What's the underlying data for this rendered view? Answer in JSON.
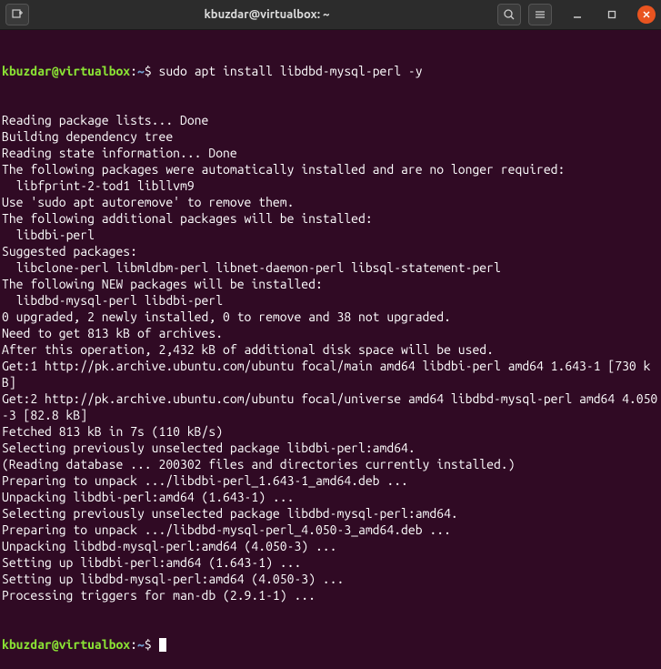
{
  "titlebar": {
    "title": "kbuzdar@virtualbox: ~"
  },
  "prompt": {
    "user": "kbuzdar@virtualbox",
    "path": "~",
    "symbol": "$"
  },
  "command": "sudo apt install libdbd-mysql-perl -y",
  "output_lines": [
    "Reading package lists... Done",
    "Building dependency tree",
    "Reading state information... Done",
    "The following packages were automatically installed and are no longer required:",
    "  libfprint-2-tod1 libllvm9",
    "Use 'sudo apt autoremove' to remove them.",
    "The following additional packages will be installed:",
    "  libdbi-perl",
    "Suggested packages:",
    "  libclone-perl libmldbm-perl libnet-daemon-perl libsql-statement-perl",
    "The following NEW packages will be installed:",
    "  libdbd-mysql-perl libdbi-perl",
    "0 upgraded, 2 newly installed, 0 to remove and 38 not upgraded.",
    "Need to get 813 kB of archives.",
    "After this operation, 2,432 kB of additional disk space will be used.",
    "Get:1 http://pk.archive.ubuntu.com/ubuntu focal/main amd64 libdbi-perl amd64 1.643-1 [730 kB]",
    "Get:2 http://pk.archive.ubuntu.com/ubuntu focal/universe amd64 libdbd-mysql-perl amd64 4.050-3 [82.8 kB]",
    "Fetched 813 kB in 7s (110 kB/s)",
    "Selecting previously unselected package libdbi-perl:amd64.",
    "(Reading database ... 200302 files and directories currently installed.)",
    "Preparing to unpack .../libdbi-perl_1.643-1_amd64.deb ...",
    "Unpacking libdbi-perl:amd64 (1.643-1) ...",
    "Selecting previously unselected package libdbd-mysql-perl:amd64.",
    "Preparing to unpack .../libdbd-mysql-perl_4.050-3_amd64.deb ...",
    "Unpacking libdbd-mysql-perl:amd64 (4.050-3) ...",
    "Setting up libdbi-perl:amd64 (1.643-1) ...",
    "Setting up libdbd-mysql-perl:amd64 (4.050-3) ...",
    "Processing triggers for man-db (2.9.1-1) ..."
  ]
}
